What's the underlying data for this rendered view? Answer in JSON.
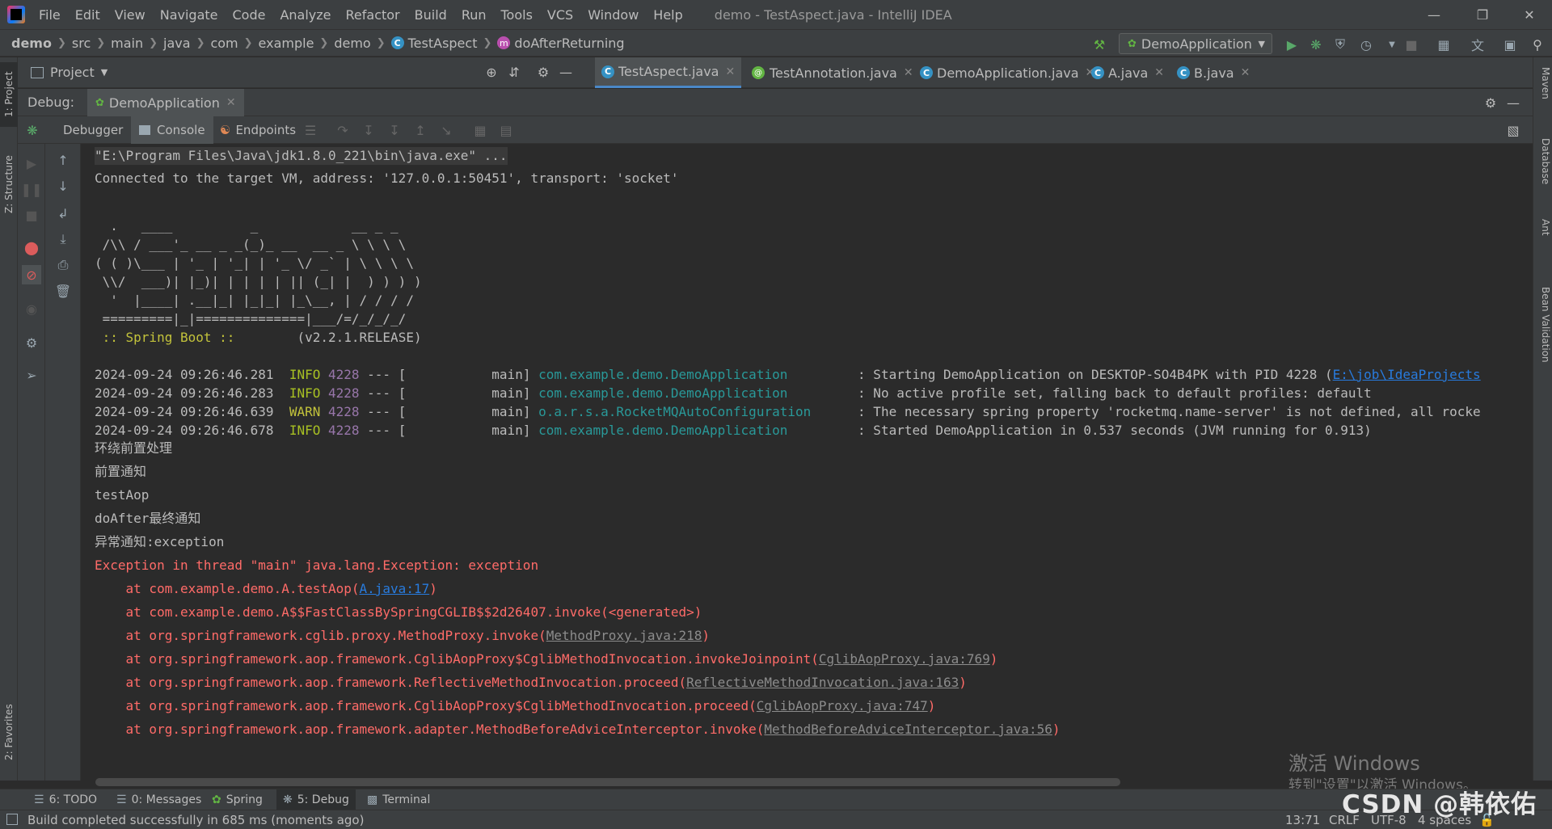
{
  "menu": {
    "items": [
      "File",
      "Edit",
      "View",
      "Navigate",
      "Code",
      "Analyze",
      "Refactor",
      "Build",
      "Run",
      "Tools",
      "VCS",
      "Window",
      "Help"
    ],
    "window_title": "demo - TestAspect.java - IntelliJ IDEA"
  },
  "nav": {
    "crumbs": [
      "demo",
      "src",
      "main",
      "java",
      "com",
      "example",
      "demo",
      "TestAspect",
      "doAfterReturning"
    ],
    "run_config": "DemoApplication"
  },
  "left_stripe": {
    "project": "1: Project",
    "structure": "Z: Structure",
    "favorites": "2: Favorites"
  },
  "right_stripe": {
    "maven": "Maven",
    "database": "Database",
    "ant": "Ant",
    "bean_validation": "Bean Validation"
  },
  "tabs": {
    "project_label": "Project",
    "editor_tabs": [
      "TestAspect.java",
      "TestAnnotation.java",
      "DemoApplication.java",
      "A.java",
      "B.java"
    ]
  },
  "debug": {
    "label": "Debug:",
    "session": "DemoApplication",
    "tabs": [
      "Debugger",
      "Console",
      "Endpoints"
    ]
  },
  "console": {
    "cmd": "\"E:\\Program Files\\Java\\jdk1.8.0_221\\bin\\java.exe\" ...",
    "connected": "Connected to the target VM, address: '127.0.0.1:50451', transport: 'socket'",
    "banner": [
      "  .   ____          _            __ _ _",
      " /\\\\ / ___'_ __ _ _(_)_ __  __ _ \\ \\ \\ \\",
      "( ( )\\___ | '_ | '_| | '_ \\/ _` | \\ \\ \\ \\",
      " \\\\/  ___)| |_)| | | | | || (_| |  ) ) ) )",
      "  '  |____| .__|_| |_|_| |_\\__, | / / / /",
      " =========|_|==============|___/=/_/_/_/"
    ],
    "spring_boot_label": " :: Spring Boot :: ",
    "spring_boot_version": "       (v2.2.1.RELEASE)",
    "logs": [
      {
        "ts": "2024-09-24 09:26:46.281",
        "level": "INFO",
        "pid": "4228",
        "thread": " --- [           main] ",
        "logger": "com.example.demo.DemoApplication        ",
        "msg": " : Starting DemoApplication on DESKTOP-SO4B4PK with PID 4228 (",
        "link": "E:\\job\\IdeaProjects"
      },
      {
        "ts": "2024-09-24 09:26:46.283",
        "level": "INFO",
        "pid": "4228",
        "thread": " --- [           main] ",
        "logger": "com.example.demo.DemoApplication        ",
        "msg": " : No active profile set, falling back to default profiles: default",
        "link": ""
      },
      {
        "ts": "2024-09-24 09:26:46.639",
        "level": "WARN",
        "pid": "4228",
        "thread": " --- [           main] ",
        "logger": "o.a.r.s.a.RocketMQAutoConfiguration     ",
        "msg": " : The necessary spring property 'rocketmq.name-server' is not defined, all rocke",
        "link": ""
      },
      {
        "ts": "2024-09-24 09:26:46.678",
        "level": "INFO",
        "pid": "4228",
        "thread": " --- [           main] ",
        "logger": "com.example.demo.DemoApplication        ",
        "msg": " : Started DemoApplication in 0.537 seconds (JVM running for 0.913)",
        "link": ""
      }
    ],
    "plain": [
      "环绕前置处理",
      "前置通知",
      "testAop",
      "doAfter最终通知",
      "异常通知:exception"
    ],
    "exception": "Exception in thread \"main\" java.lang.Exception: exception",
    "stack": [
      {
        "text": "    at com.example.demo.A.testAop(",
        "link": "A.java:17",
        "tail": ")",
        "blue": true
      },
      {
        "text": "    at com.example.demo.A$$FastClassBySpringCGLIB$$2d26407.invoke(<generated>)",
        "link": "",
        "tail": "",
        "blue": false
      },
      {
        "text": "    at org.springframework.cglib.proxy.MethodProxy.invoke(",
        "link": "MethodProxy.java:218",
        "tail": ")",
        "blue": false
      },
      {
        "text": "    at org.springframework.aop.framework.CglibAopProxy$CglibMethodInvocation.invokeJoinpoint(",
        "link": "CglibAopProxy.java:769",
        "tail": ")",
        "blue": false
      },
      {
        "text": "    at org.springframework.aop.framework.ReflectiveMethodInvocation.proceed(",
        "link": "ReflectiveMethodInvocation.java:163",
        "tail": ")",
        "blue": false
      },
      {
        "text": "    at org.springframework.aop.framework.CglibAopProxy$CglibMethodInvocation.proceed(",
        "link": "CglibAopProxy.java:747",
        "tail": ")",
        "blue": false
      },
      {
        "text": "    at org.springframework.aop.framework.adapter.MethodBeforeAdviceInterceptor.invoke(",
        "link": "MethodBeforeAdviceInterceptor.java:56",
        "tail": ")",
        "blue": false
      }
    ]
  },
  "bottom_tabs": [
    "6: TODO",
    "0: Messages",
    "Spring",
    "5: Debug",
    "Terminal"
  ],
  "status": {
    "message": "Build completed successfully in 685 ms (moments ago)",
    "position": "13:71",
    "line_sep": "CRLF",
    "encoding": "UTF-8",
    "indent": "4 spaces"
  },
  "watermark": {
    "activate": "激活 Windows",
    "activate_sub": "转到\"设置\"以激活 Windows。",
    "csdn": "CSDN @韩依佑"
  },
  "colors": {
    "accent": "#4a88c7",
    "info": "#a8c023",
    "warn": "#c3c33b",
    "error": "#ff6b68",
    "logger": "#299999",
    "link": "#287bde"
  }
}
